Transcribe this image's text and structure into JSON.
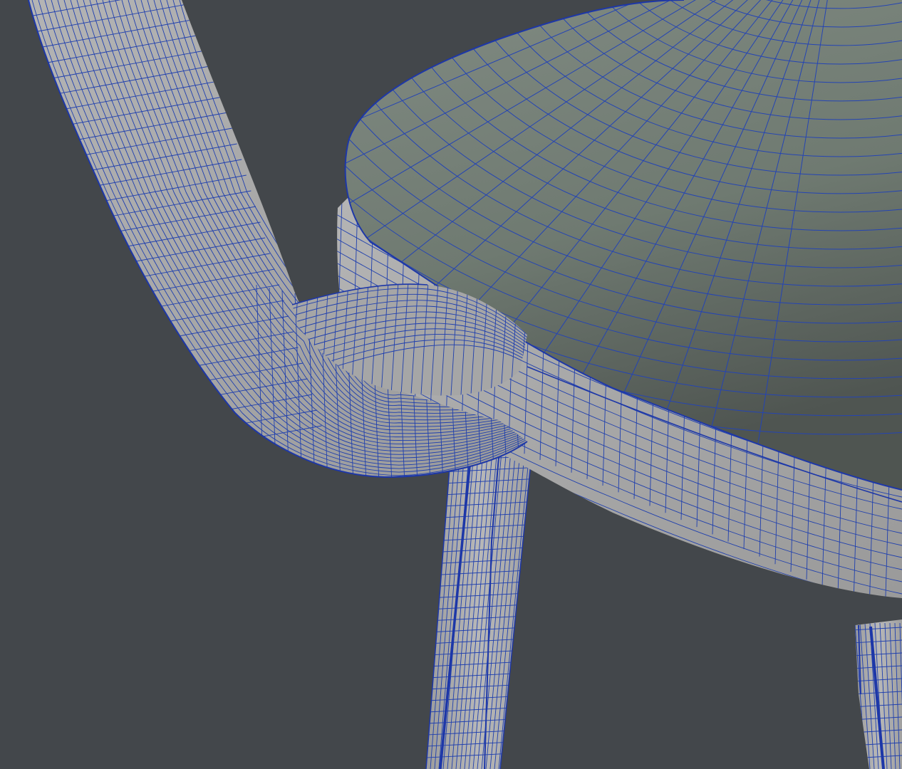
{
  "viewport": {
    "background_color": "#43474b",
    "wood_color": "#a9a9a9",
    "cushion_color": "#717b72",
    "wire_color": "#1f3fae"
  },
  "scene": {
    "parts": [
      "backrest-post",
      "arm-rail",
      "seat-rail",
      "seat-cushion",
      "front-leg",
      "rear-leg"
    ]
  }
}
